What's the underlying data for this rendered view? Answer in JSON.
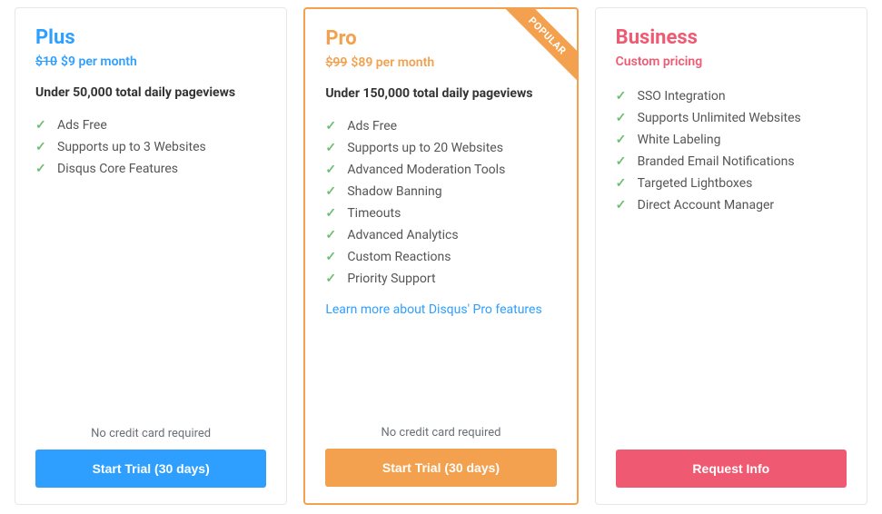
{
  "plans": [
    {
      "id": "plus",
      "title": "Plus",
      "title_color": "#2e9fff",
      "old_price": "$10",
      "price_text": "$9 per month",
      "price_color": "#2e9fff",
      "subhead": "Under 50,000 total daily pageviews",
      "features": [
        "Ads Free",
        "Supports up to 3 Websites",
        "Disqus Core Features"
      ],
      "learn_link": "",
      "note": "No credit card required",
      "button_label": "Start Trial (30 days)",
      "button_color": "#2e9fff",
      "highlight": false,
      "ribbon": ""
    },
    {
      "id": "pro",
      "title": "Pro",
      "title_color": "#f3a14e",
      "old_price": "$99",
      "price_text": "$89 per month",
      "price_color": "#f3a14e",
      "subhead": "Under 150,000 total daily pageviews",
      "features": [
        "Ads Free",
        "Supports up to 20 Websites",
        "Advanced Moderation Tools",
        "Shadow Banning",
        "Timeouts",
        "Advanced Analytics",
        "Custom Reactions",
        "Priority Support"
      ],
      "learn_link": "Learn more about Disqus' Pro features",
      "note": "No credit card required",
      "button_label": "Start Trial (30 days)",
      "button_color": "#f3a14e",
      "highlight": true,
      "ribbon": "POPULAR"
    },
    {
      "id": "business",
      "title": "Business",
      "title_color": "#ef5a72",
      "old_price": "",
      "price_text": "Custom pricing",
      "price_color": "#ef5a72",
      "subhead": "",
      "features": [
        "SSO Integration",
        "Supports Unlimited Websites",
        "White Labeling",
        "Branded Email Notifications",
        "Targeted Lightboxes",
        "Direct Account Manager"
      ],
      "learn_link": "",
      "note": "",
      "button_label": "Request Info",
      "button_color": "#ef5a72",
      "highlight": false,
      "ribbon": ""
    }
  ]
}
